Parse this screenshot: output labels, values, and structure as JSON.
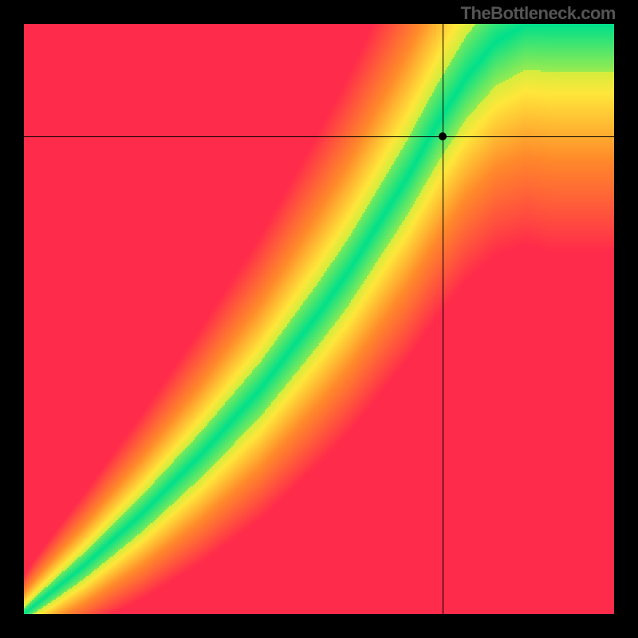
{
  "attribution": "TheBottleneck.com",
  "chart_data": {
    "type": "heatmap",
    "title": "",
    "xlabel": "",
    "ylabel": "",
    "xlim": [
      0,
      100
    ],
    "ylim": [
      0,
      100
    ],
    "colormap_description": "red (worst) → orange → yellow → green (best match)",
    "optimal_ridge": {
      "description": "Green optimal band: y as function of x, roughly y/x ratio along a superlinear curve",
      "points_x": [
        0,
        10,
        20,
        30,
        40,
        50,
        55,
        60,
        65,
        70,
        75,
        80,
        85,
        90
      ],
      "points_y": [
        0,
        8,
        17,
        27,
        38,
        51,
        58,
        66,
        74,
        83,
        91,
        97,
        100,
        100
      ],
      "band_halfwidth_start": 1,
      "band_halfwidth_end": 8
    },
    "crosshair": {
      "x": 71,
      "y": 81
    },
    "marker": {
      "x": 71,
      "y": 81
    },
    "colors": {
      "red": "#ff2b4a",
      "orange": "#ff8a2a",
      "yellow": "#ffe63a",
      "yellowgreen": "#c7ef3e",
      "green": "#00e08a"
    }
  }
}
